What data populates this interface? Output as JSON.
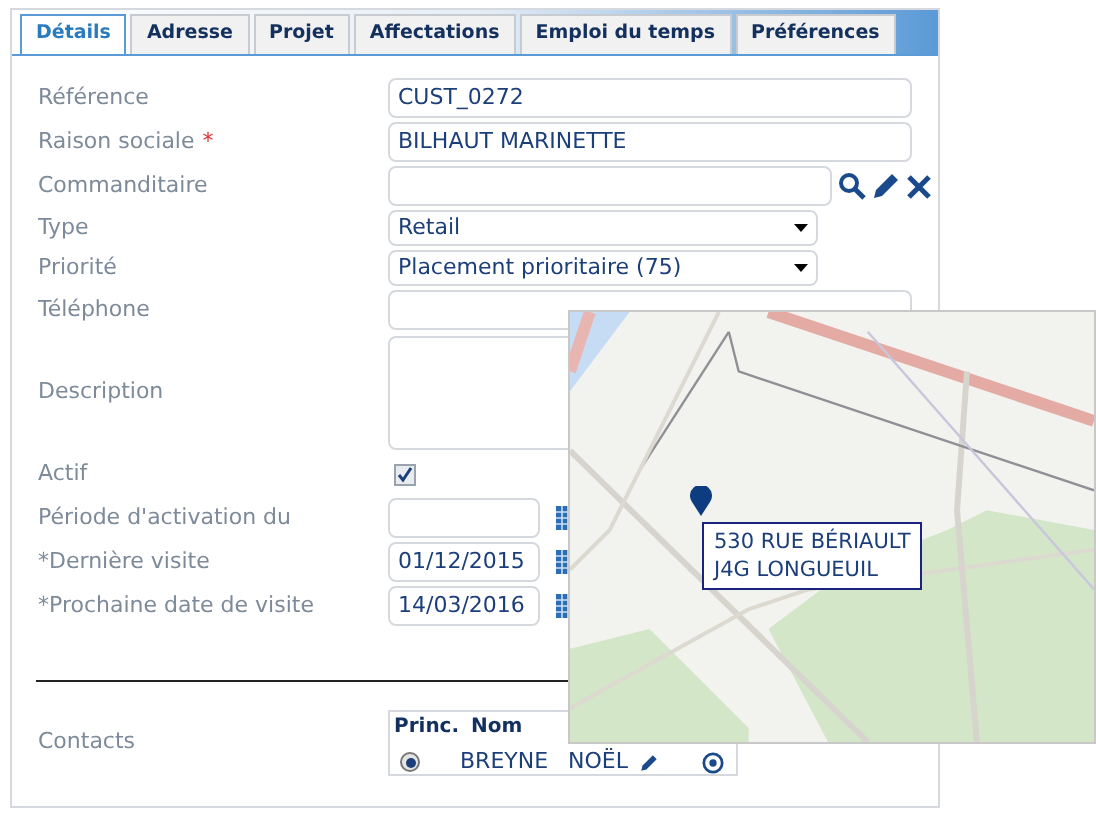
{
  "tabs": [
    {
      "label": "Détails",
      "selected": true
    },
    {
      "label": "Adresse",
      "selected": false
    },
    {
      "label": "Projet",
      "selected": false
    },
    {
      "label": "Affectations",
      "selected": false
    },
    {
      "label": "Emploi du temps",
      "selected": false
    },
    {
      "label": "Préférences",
      "selected": false
    }
  ],
  "fields": [
    {
      "kind": "text",
      "label": "Référence",
      "value": "CUST_0272"
    },
    {
      "kind": "text",
      "label": "Raison sociale",
      "required_mark": "*",
      "value": "BILHAUT MARINETTE"
    },
    {
      "kind": "lookup",
      "label": "Commanditaire"
    },
    {
      "kind": "select",
      "label": "Type",
      "value": "Retail"
    },
    {
      "kind": "select",
      "label": "Priorité",
      "value": "Placement prioritaire (75)"
    },
    {
      "kind": "text",
      "label": "Téléphone"
    },
    {
      "kind": "textarea",
      "label": "Description"
    },
    {
      "kind": "checkbox",
      "label": "Actif",
      "checked": true
    },
    {
      "kind": "date",
      "label": "Période d'activation du"
    },
    {
      "kind": "date",
      "label": "*Dernière visite",
      "value": "01/12/2015"
    },
    {
      "kind": "date",
      "label": "*Prochaine date de visite",
      "value": "14/03/2016"
    }
  ],
  "contacts": {
    "label": "Contacts",
    "columns": [
      "Princ.",
      "Nom"
    ],
    "rows": [
      {
        "selected": true,
        "name": "BREYNE",
        "first_name": "NOËL"
      }
    ]
  },
  "map": {
    "address_lines": [
      "530 RUE BÉRIAULT",
      "J4G LONGUEUIL"
    ]
  }
}
